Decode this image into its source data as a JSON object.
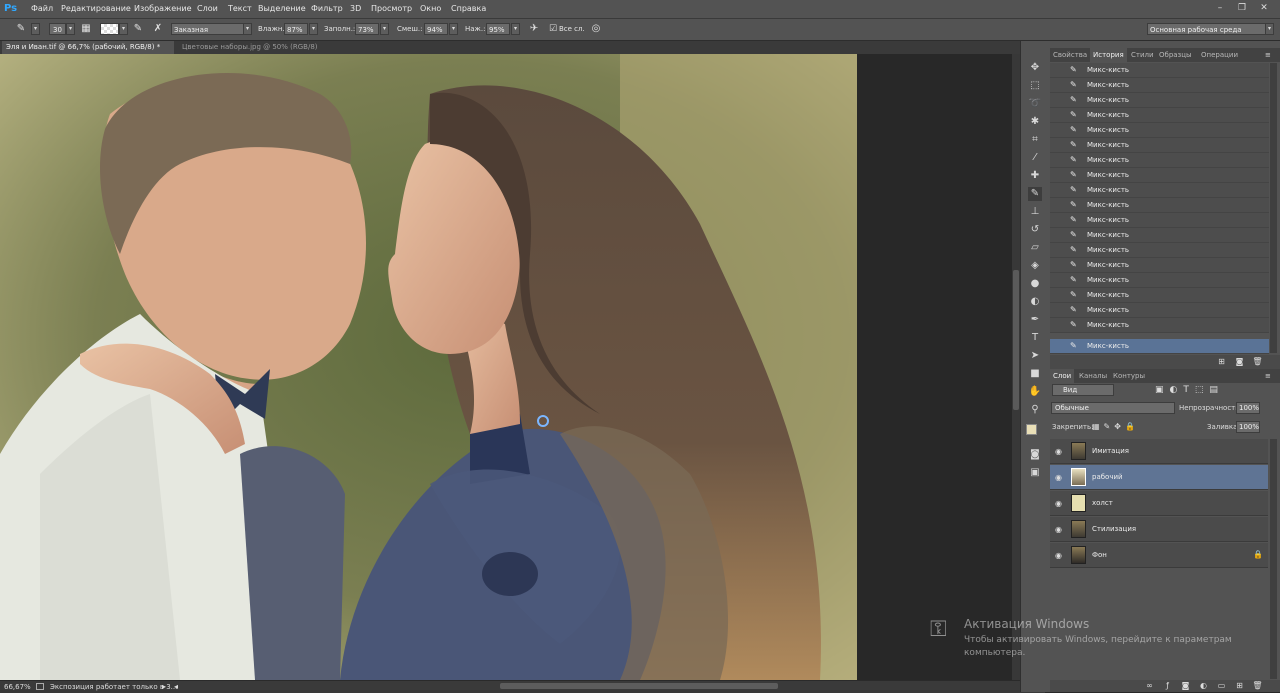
{
  "app": {
    "logo": "Ps"
  },
  "menu": [
    "Файл",
    "Редактирование",
    "Изображение",
    "Слои",
    "Текст",
    "Выделение",
    "Фильтр",
    "3D",
    "Просмотр",
    "Окно",
    "Справка"
  ],
  "options": {
    "brush_size": "30",
    "preset": "Заказная",
    "wet_label": "Влажн.:",
    "wet_value": "87%",
    "load_label": "Заполн.:",
    "load_value": "73%",
    "mix_label": "Смеш.:",
    "mix_value": "94%",
    "flow_label": "Наж.:",
    "flow_value": "95%",
    "sample_all_label": "Все сл.",
    "workspace": "Основная рабочая среда"
  },
  "tabs": [
    {
      "label": "Эля и Иван.tif @ 66,7% (рабочий, RGB/8) *",
      "active": true
    },
    {
      "label": "Цветовые наборы.jpg @ 50% (RGB/8)",
      "active": false
    }
  ],
  "status": {
    "zoom": "66,67%",
    "info": "Экспозиция работает только в 3..."
  },
  "panel_tabs_top": [
    "Свойства",
    "История",
    "Стили",
    "Образцы",
    "Операции"
  ],
  "history": {
    "items": [
      "Микс-кисть",
      "Микс-кисть",
      "Микс-кисть",
      "Микс-кисть",
      "Микс-кисть",
      "Микс-кисть",
      "Микс-кисть",
      "Микс-кисть",
      "Микс-кисть",
      "Микс-кисть",
      "Микс-кисть",
      "Микс-кисть",
      "Микс-кисть",
      "Микс-кисть",
      "Микс-кисть",
      "Микс-кисть",
      "Микс-кисть",
      "Микс-кисть",
      "Микс-кисть"
    ]
  },
  "layers_panel": {
    "tabs": [
      "Слои",
      "Каналы",
      "Контуры"
    ],
    "filter": "Вид",
    "blend_mode": "Обычные",
    "opacity_label": "Непрозрачность:",
    "opacity_value": "100%",
    "lock_label": "Закрепить:",
    "fill_label": "Заливка:",
    "fill_value": "100%",
    "layers": [
      {
        "name": "Имитация",
        "selected": false,
        "locked": false
      },
      {
        "name": "рабочий",
        "selected": true,
        "locked": false
      },
      {
        "name": "холст",
        "selected": false,
        "locked": false
      },
      {
        "name": "Стилизация",
        "selected": false,
        "locked": false
      },
      {
        "name": "Фон",
        "selected": false,
        "locked": true
      }
    ]
  },
  "watermark": {
    "title": "Активация Windows",
    "line1": "Чтобы активировать Windows, перейдите к параметрам",
    "line2": "компьютера."
  },
  "colors": {
    "accent": "#31a8ff",
    "selection": "#5a7396",
    "panel": "#535353"
  }
}
